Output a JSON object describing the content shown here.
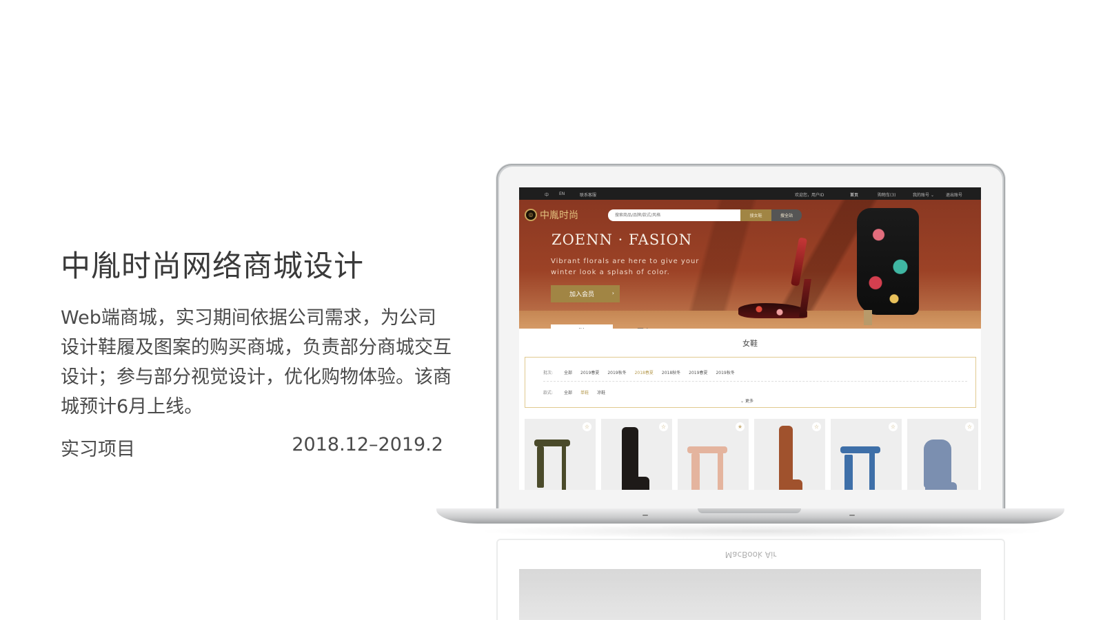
{
  "intro": {
    "title": "中胤时尚网络商城设计",
    "description": "Web端商城，实习期间依据公司需求，为公司设计鞋履及图案的购买商城，负责部分商城交互设计；参与部分视觉设计，优化购物体验。该商城预计6月上线。",
    "type": "实习项目",
    "period": "2018.12–2019.2"
  },
  "reflection": {
    "label": "MacBook Air"
  },
  "site": {
    "topbar": {
      "lang_cn": "中",
      "lang_en": "EN",
      "service": "联系客服",
      "welcome": "欢迎您，用户ID",
      "home": "首页",
      "cart": "购物车(3)",
      "account": "我的账号",
      "logout": "退出账号"
    },
    "logo_text": "中胤时尚",
    "search": {
      "placeholder": "搜索商品/品牌/款式/风格",
      "btn_primary": "搜女鞋",
      "btn_secondary": "搜全站"
    },
    "brand": "ZOENN · FASION",
    "tagline": "Vibrant florals are here to give your winter look a splash of color.",
    "join_button": "加入会员",
    "tabs": [
      "鞋",
      "图案"
    ],
    "section_title": "女鞋",
    "filters": {
      "season_label": "批次:",
      "season_options": [
        "全部",
        "2019春夏",
        "2019秋冬",
        "2018春夏",
        "2018秋冬",
        "2019春夏",
        "2019秋冬"
      ],
      "season_selected_index": 3,
      "style_label": "款式:",
      "style_options": [
        "全部",
        "单鞋",
        "凉鞋"
      ],
      "style_selected_index": 1,
      "more": "更多"
    },
    "products": [
      {
        "favorited": false,
        "color": "#4a4a2a"
      },
      {
        "favorited": false,
        "color": "#1e1a18"
      },
      {
        "favorited": true,
        "color": "#e4b49e"
      },
      {
        "favorited": false,
        "color": "#a0522d"
      },
      {
        "favorited": false,
        "color": "#3e6fa8"
      },
      {
        "favorited": false,
        "color": "#7b8fb0"
      }
    ]
  }
}
